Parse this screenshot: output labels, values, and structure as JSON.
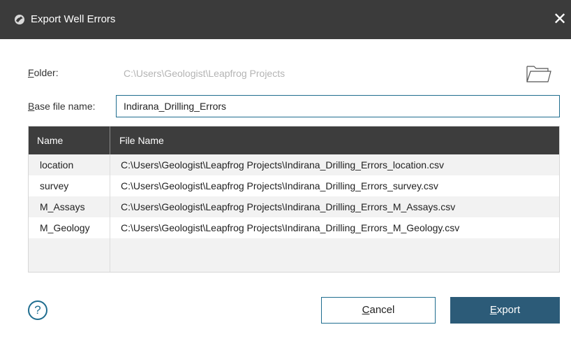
{
  "window": {
    "title": "Export Well Errors",
    "close_glyph": "✕",
    "app_icon": "leapfrog-logo-icon"
  },
  "form": {
    "folder_label_accel": "F",
    "folder_label_rest": "older:",
    "folder_value": "C:\\Users\\Geologist\\Leapfrog Projects",
    "folder_button_icon": "folder-icon",
    "basename_label_accel": "B",
    "basename_label_rest": "ase file name:",
    "basename_value": "Indirana_Drilling_Errors"
  },
  "table": {
    "headers": [
      "Name",
      "File Name"
    ],
    "rows": [
      {
        "name": "location",
        "file": "C:\\Users\\Geologist\\Leapfrog Projects\\Indirana_Drilling_Errors_location.csv"
      },
      {
        "name": "survey",
        "file": "C:\\Users\\Geologist\\Leapfrog Projects\\Indirana_Drilling_Errors_survey.csv"
      },
      {
        "name": "M_Assays",
        "file": "C:\\Users\\Geologist\\Leapfrog Projects\\Indirana_Drilling_Errors_M_Assays.csv"
      },
      {
        "name": "M_Geology",
        "file": "C:\\Users\\Geologist\\Leapfrog Projects\\Indirana_Drilling_Errors_M_Geology.csv"
      }
    ]
  },
  "footer": {
    "help_glyph": "?",
    "cancel_accel": "C",
    "cancel_rest": "ancel",
    "export_accel": "E",
    "export_rest": "xport"
  },
  "colors": {
    "titlebar": "#3b3b3b",
    "table_header": "#3d3d3d",
    "accent": "#1f6d8f",
    "primary_button": "#2c5b78"
  }
}
